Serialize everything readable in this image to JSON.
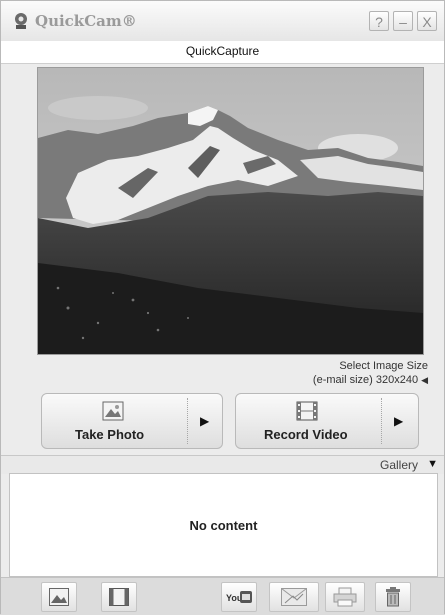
{
  "app": {
    "title": "QuickCam®"
  },
  "titlebar": {
    "help": "?",
    "minimize": "–",
    "close": "X"
  },
  "subtitle": "QuickCapture",
  "image_size": {
    "label": "Select Image Size",
    "value": "(e-mail size) 320x240"
  },
  "buttons": {
    "take_photo": "Take Photo",
    "record_video": "Record Video"
  },
  "gallery": {
    "label": "Gallery",
    "empty_text": "No content"
  },
  "toolbar": {
    "youtube_label": "You"
  },
  "icons": {
    "logo": "webcam-icon",
    "photo": "photo-icon",
    "video": "film-icon",
    "youtube": "youtube-icon",
    "email": "email-icon",
    "print": "printer-icon",
    "delete": "trash-icon"
  },
  "colors": {
    "background": "#ececec",
    "title_text": "#9a9a9a"
  }
}
